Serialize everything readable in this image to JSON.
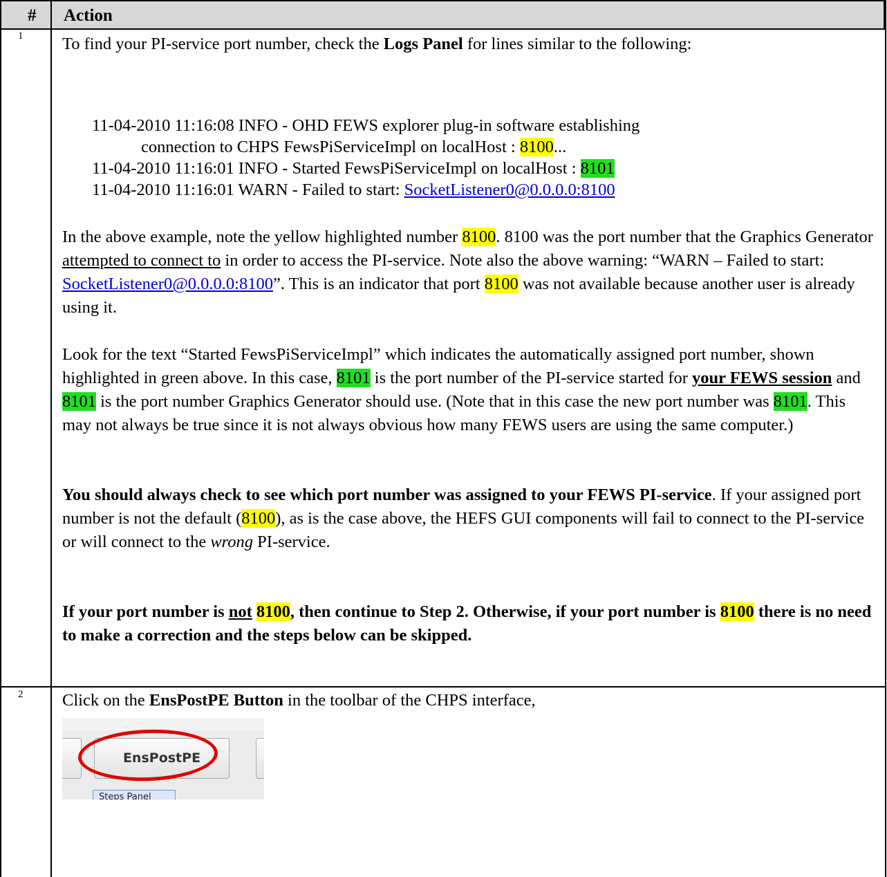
{
  "header": {
    "num": "#",
    "action": "Action"
  },
  "rows": [
    {
      "num": "1"
    },
    {
      "num": "2"
    }
  ],
  "step1": {
    "intro_a": "To find your PI-service port number, check the ",
    "intro_bold": "Logs Panel",
    "intro_b": " for lines similar to the following:",
    "log1_a": "11-04-2010 11:16:08 INFO - OHD FEWS explorer plug-in software establishing",
    "log1_b": "connection to CHPS FewsPiServiceImpl on localHost : ",
    "log1_port": "8100",
    "log1_tail": "...",
    "log2_a": "11-04-2010 11:16:01 INFO - Started FewsPiServiceImpl on localHost : ",
    "log2_port": "8101",
    "log3_a": "11-04-2010 11:16:01 WARN - Failed to start: ",
    "log3_link": "SocketListener0@0.0.0.0:8100",
    "p1_a": "In the above example, note the yellow highlighted number ",
    "p1_port": "8100",
    "p1_b": ".  8100 was the port number that the Graphics Generator ",
    "p1_u": "attempted to connect to",
    "p1_c": " in order to access the PI-service.  Note also the above warning: “WARN – Failed to start: ",
    "p1_link": "SocketListener0@0.0.0.0:8100",
    "p1_d": "”. This is an indicator that port ",
    "p1_port2": "8100",
    "p1_e": " was not available because another user is already using it.",
    "p2_a": "Look for the text “Started FewsPiServiceImpl” which indicates the automatically assigned port number, shown highlighted in green above.  In this case, ",
    "p2_port": "8101",
    "p2_b": " is the port number of the PI-service started for ",
    "p2_bu": "your FEWS session",
    "p2_c": " and ",
    "p2_port2": "8101",
    "p2_d": " is the port number Graphics Generator should use. (Note that in this case the new port number was ",
    "p2_port3": "8101",
    "p2_e": ". This may not always be true since it is not always obvious how many FEWS users are using the same computer.)",
    "p3_bold": "You should always check to see which port number was assigned to your FEWS PI-service",
    "p3_a": ".  If your assigned port number is not the default (",
    "p3_port": "8100",
    "p3_b": "), as is the case above, the HEFS GUI components will fail to connect to the PI-service or will connect to the ",
    "p3_i": "wrong",
    "p3_c": " PI-service.",
    "p4_a": "If your port number is ",
    "p4_u": "not",
    "p4_sp": " ",
    "p4_port": "8100",
    "p4_b": ", then continue to Step 2.  Otherwise, if your port number is ",
    "p4_port2": "8100",
    "p4_c": " there is no need to make a correction and the steps below can be skipped."
  },
  "step2": {
    "a": "Click on the ",
    "bold": "EnsPostPE Button",
    "b": " in the toolbar of the CHPS interface,",
    "button_label": "EnsPostPE",
    "tab_label": "Steps Panel",
    "highlight_color": "#e00000"
  }
}
